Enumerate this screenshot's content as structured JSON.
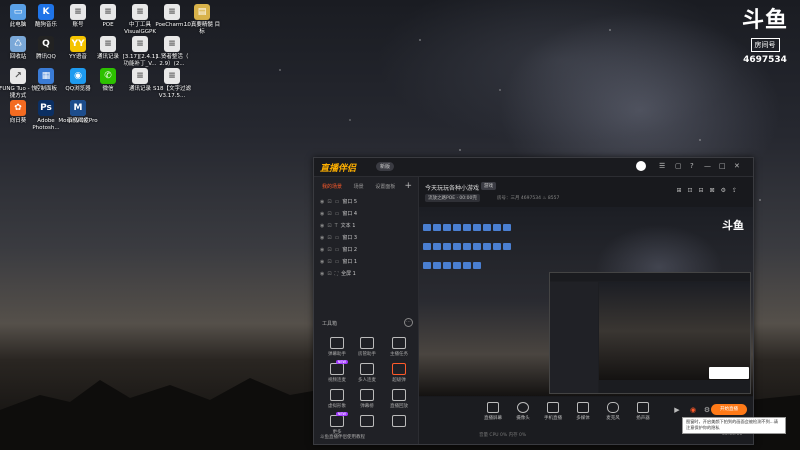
{
  "desktop_icons": [
    {
      "label": "此电脑",
      "color": "#5aa0e6",
      "glyph": "▭"
    },
    {
      "label": "酷狗音乐",
      "color": "#1f74e8",
      "glyph": "K"
    },
    {
      "label": "账号",
      "color": "#e8e8e8",
      "glyph": "≡"
    },
    {
      "label": "POE",
      "color": "#e8e8e8",
      "glyph": "≡"
    },
    {
      "label": "中丁工具 VisualGGPK",
      "color": "#e8e8e8",
      "glyph": "≡"
    },
    {
      "label": "PoeCharm...",
      "color": "#e8e8e8",
      "glyph": "≡"
    },
    {
      "label": "10真要精髓 目标",
      "color": "#d8b24a",
      "glyph": "▤"
    },
    {
      "label": "回收站",
      "color": "#7aa8d8",
      "glyph": "♺"
    },
    {
      "label": "腾讯QQ",
      "color": "#222",
      "glyph": "Q"
    },
    {
      "label": "YY语音",
      "color": "#f5c400",
      "glyph": "YY"
    },
    {
      "label": "通讯记录",
      "color": "#e8e8e8",
      "glyph": "≡"
    },
    {
      "label": "[3.17][2.4.1] 功能补丁_V...",
      "color": "#e8e8e8",
      "glyph": "≡"
    },
    {
      "label": "1.贤者整活（ 2.9）(2...",
      "color": "#e8e8e8",
      "glyph": "≡"
    },
    {
      "label": "FUNG Tuo - 快捷方式",
      "color": "#e8e8e8",
      "glyph": "↗"
    },
    {
      "label": "控制面板",
      "color": "#3a7bd5",
      "glyph": "▦"
    },
    {
      "label": "QQ浏览器",
      "color": "#1e9bf0",
      "glyph": "◉"
    },
    {
      "label": "微信",
      "color": "#2dc100",
      "glyph": "✆"
    },
    {
      "label": "通讯记录",
      "color": "#e8e8e8",
      "glyph": "≡"
    },
    {
      "label": "S18【文字过滤V3.17.5...",
      "color": "#e8e8e8",
      "glyph": "≡"
    },
    {
      "label": "向日葵",
      "color": "#f36b21",
      "glyph": "✿"
    },
    {
      "label": "Adobe Photosh...",
      "color": "#0b2f63",
      "glyph": "Ps"
    },
    {
      "label": "百度网盘",
      "color": "#3a8ef6",
      "glyph": "☁"
    },
    {
      "label": "MorphVOX Pro",
      "color": "#1d4d8c",
      "glyph": "M"
    }
  ],
  "brand": {
    "logo": "斗鱼",
    "room_label": "房间号",
    "room_number": "4697534"
  },
  "app": {
    "name": "直播伴侣",
    "version_badge": "新版",
    "left_tabs": [
      "我的场景",
      "场景",
      "设置面板"
    ],
    "sources": [
      {
        "label": "窗口 5"
      },
      {
        "label": "窗口 4"
      },
      {
        "label": "文本 1"
      },
      {
        "label": "窗口 3"
      },
      {
        "label": "窗口 2"
      },
      {
        "label": "窗口 1"
      },
      {
        "label": "全屏 1"
      }
    ],
    "toolbox_title": "工具箱",
    "tools": [
      {
        "label": "弹幕助手",
        "hot": ""
      },
      {
        "label": "房管助手",
        "hot": ""
      },
      {
        "label": "主播任务",
        "hot": ""
      },
      {
        "label": "视频连麦",
        "hot": "NEW"
      },
      {
        "label": "多人连麦",
        "hot": ""
      },
      {
        "label": "超级弹",
        "hot": "",
        "accent": true
      },
      {
        "label": "虚拟形象",
        "hot": ""
      },
      {
        "label": "弹幕榜",
        "hot": ""
      },
      {
        "label": "直播回放",
        "hot": ""
      },
      {
        "label": "更多",
        "hot": "NEW"
      },
      {
        "label": "",
        "hot": ""
      },
      {
        "label": "",
        "hot": ""
      }
    ],
    "bottom_note": "斗鱼直播伴侣使用教程",
    "room_title": "今天玩玩各种小游戏",
    "room_tag": "游戏",
    "category_chip": "流放之路POE · 00:00完",
    "sub_info": "房号：三月  4697534   ♨ 8557",
    "controls": [
      {
        "label": "直播屏幕"
      },
      {
        "label": "摄像头"
      },
      {
        "label": "手机直播"
      },
      {
        "label": "多媒体"
      },
      {
        "label": "麦克风"
      },
      {
        "label": "扬声器"
      }
    ],
    "live_button": "开始直播",
    "timer": "00:00:00",
    "status_row": "音量 CPU 0%  内存 0%"
  },
  "tooltip": "图窗时，开启美颜下拍到的画面会被检测不到...请注意保护你的隐私"
}
